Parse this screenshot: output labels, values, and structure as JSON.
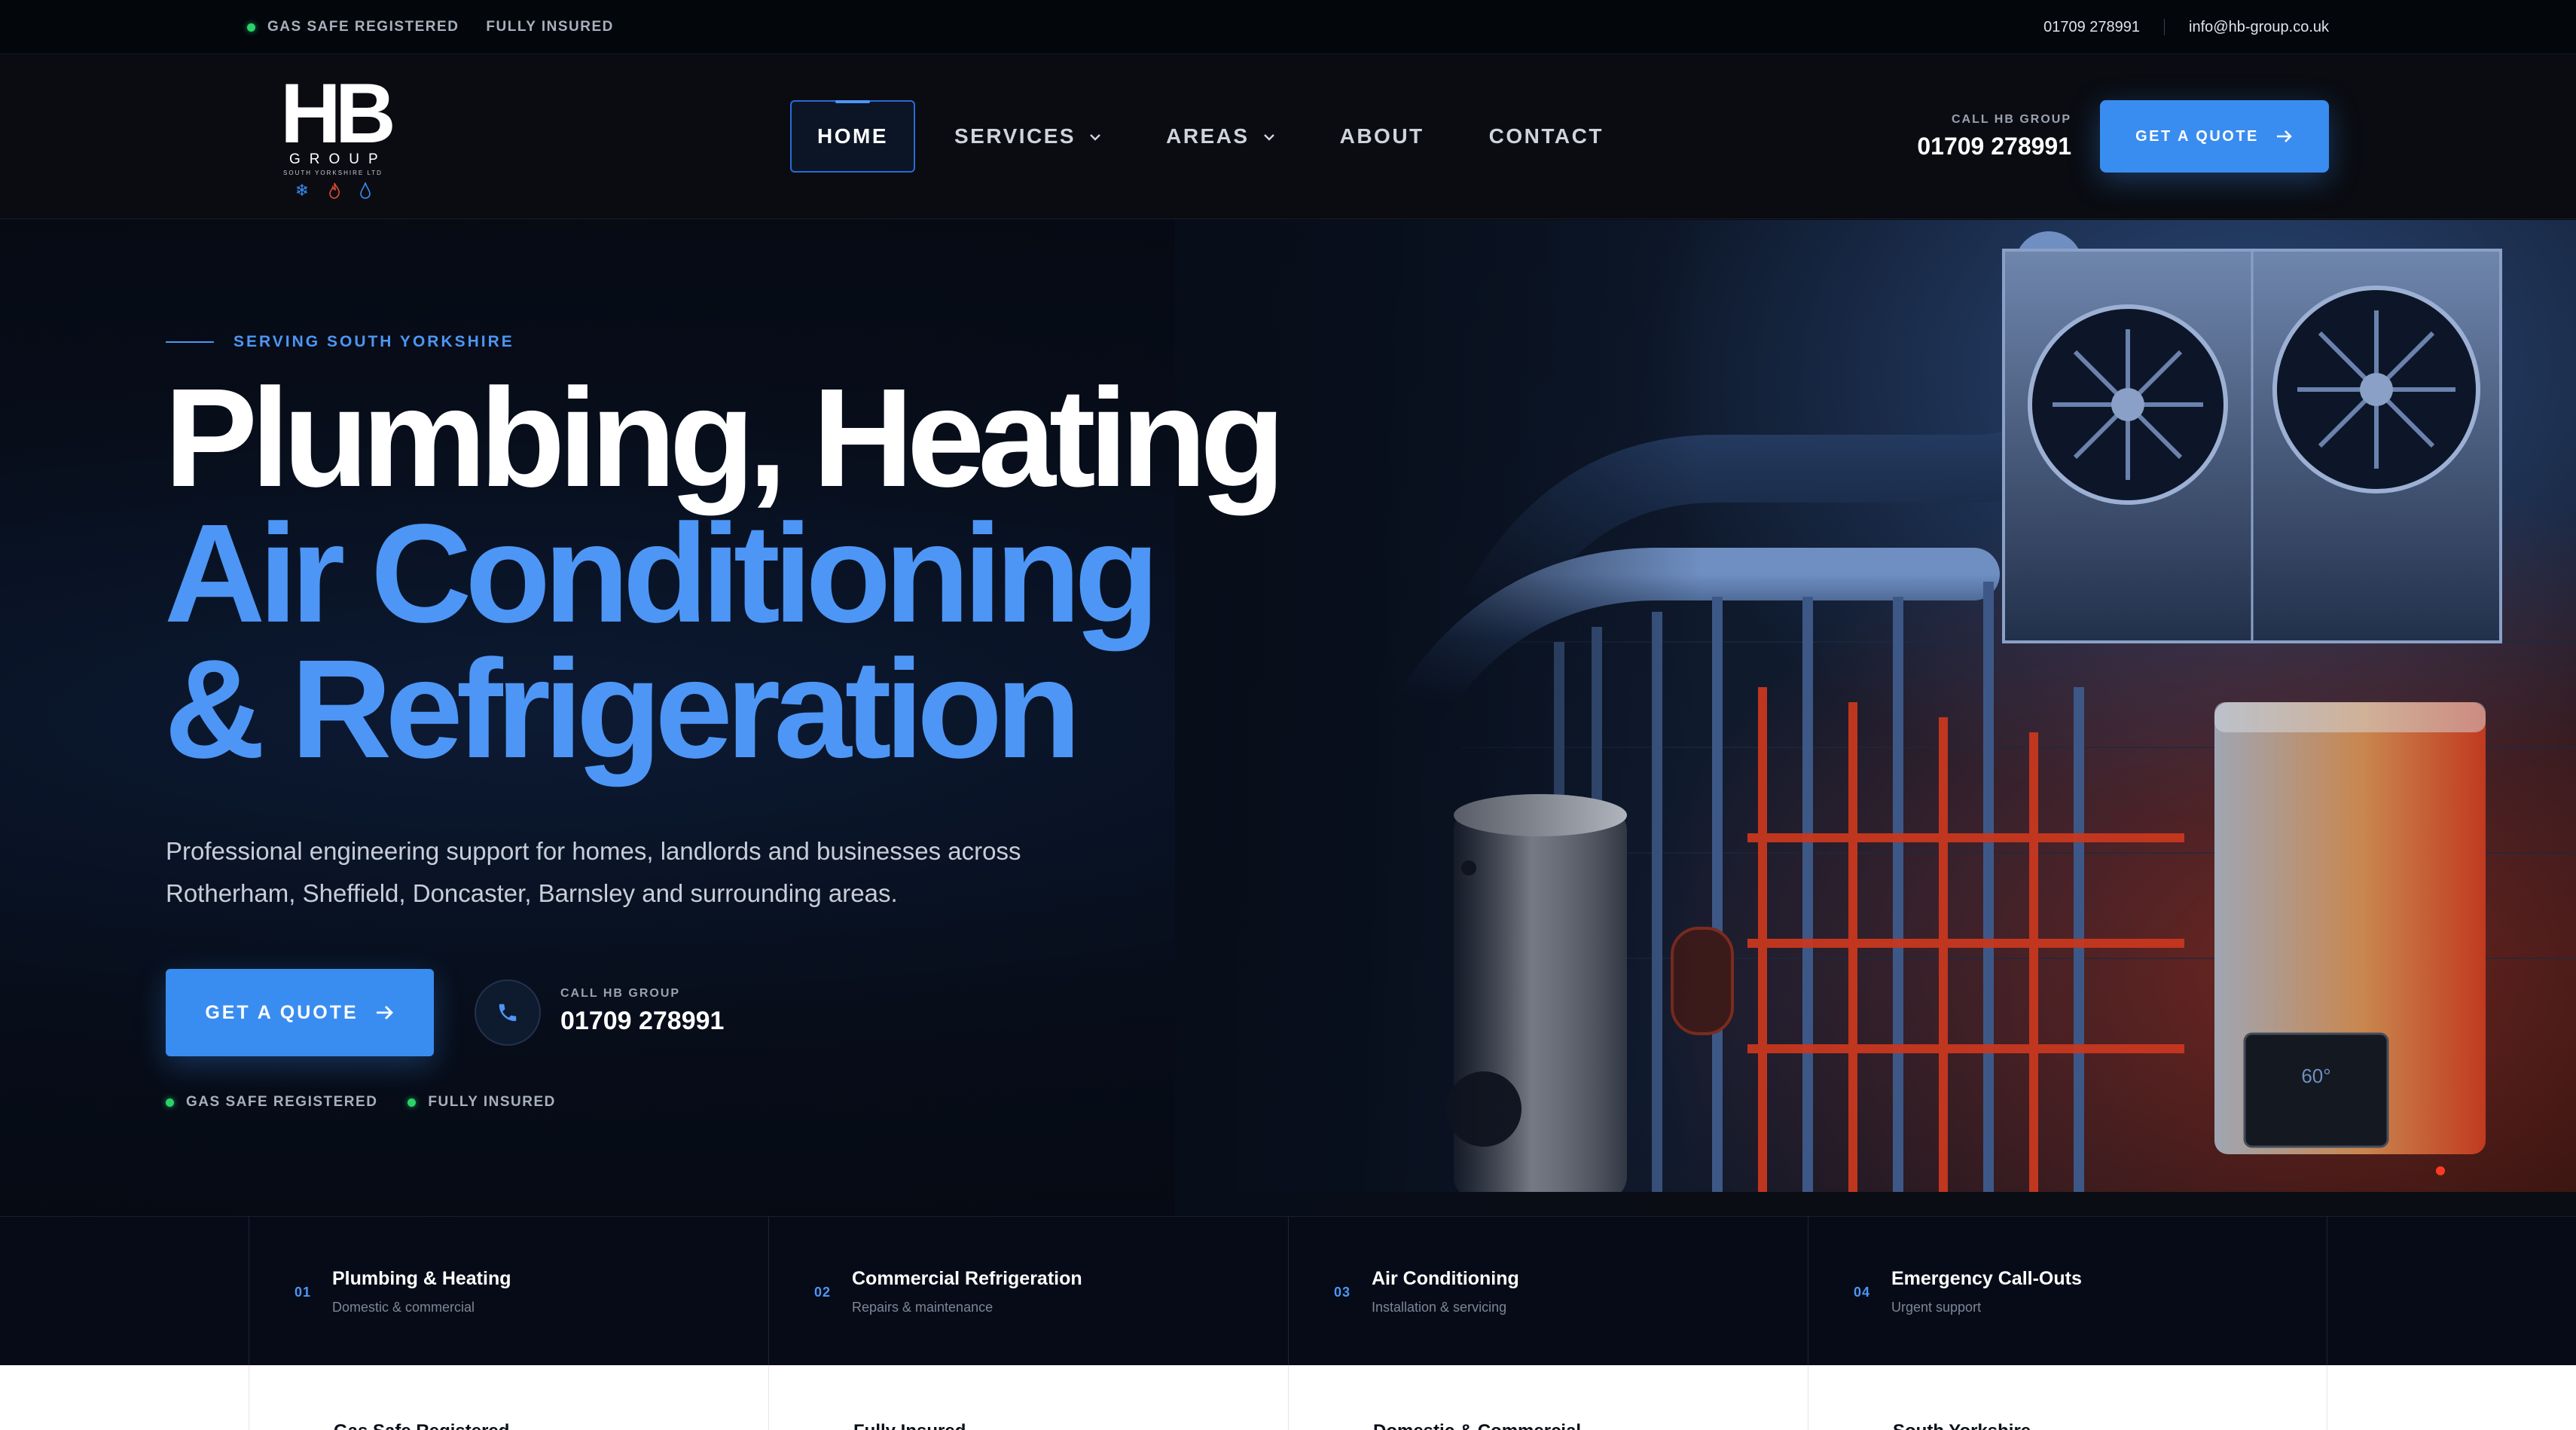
{
  "topbar": {
    "badge1": "GAS SAFE REGISTERED",
    "badge2": "FULLY INSURED",
    "phone": "01709 278991",
    "email": "info@hb-group.co.uk"
  },
  "logo": {
    "mark": "HB",
    "word": "GROUP",
    "tagline": "SOUTH YORKSHIRE LTD",
    "icons": [
      "snowflake-icon",
      "flame-icon",
      "water-drop-icon"
    ]
  },
  "nav": {
    "items": [
      {
        "label": "HOME",
        "active": true
      },
      {
        "label": "SERVICES",
        "dropdown": true
      },
      {
        "label": "AREAS",
        "dropdown": true
      },
      {
        "label": "ABOUT"
      },
      {
        "label": "CONTACT"
      }
    ]
  },
  "header_call": {
    "label": "CALL HB GROUP",
    "number": "01709 278991"
  },
  "header_cta": {
    "label": "GET A QUOTE"
  },
  "hero": {
    "eyebrow": "SERVING SOUTH YORKSHIRE",
    "title_line1": "Plumbing, Heating",
    "title_line2": "Air Conditioning",
    "title_line3": "& Refrigeration",
    "lede": "Professional engineering support for homes, landlords and businesses across Rotherham, Sheffield, Doncaster, Barnsley and surrounding areas.",
    "cta": "GET A QUOTE",
    "call_label": "CALL HB GROUP",
    "call_number": "01709 278991",
    "badges": [
      "GAS SAFE REGISTERED",
      "FULLY INSURED"
    ],
    "boiler_display": "60°"
  },
  "services": [
    {
      "num": "01",
      "title": "Plumbing & Heating",
      "sub": "Domestic & commercial"
    },
    {
      "num": "02",
      "title": "Commercial Refrigeration",
      "sub": "Repairs & maintenance"
    },
    {
      "num": "03",
      "title": "Air Conditioning",
      "sub": "Installation & servicing"
    },
    {
      "num": "04",
      "title": "Emergency Call-Outs",
      "sub": "Urgent support"
    }
  ],
  "features": [
    "Gas Safe Registered",
    "Fully Insured",
    "Domestic & Commercial",
    "South Yorkshire"
  ],
  "colors": {
    "accent": "#4d96f5",
    "button": "#3a8df0",
    "status_green": "#28d46a",
    "background": "#060a12"
  }
}
